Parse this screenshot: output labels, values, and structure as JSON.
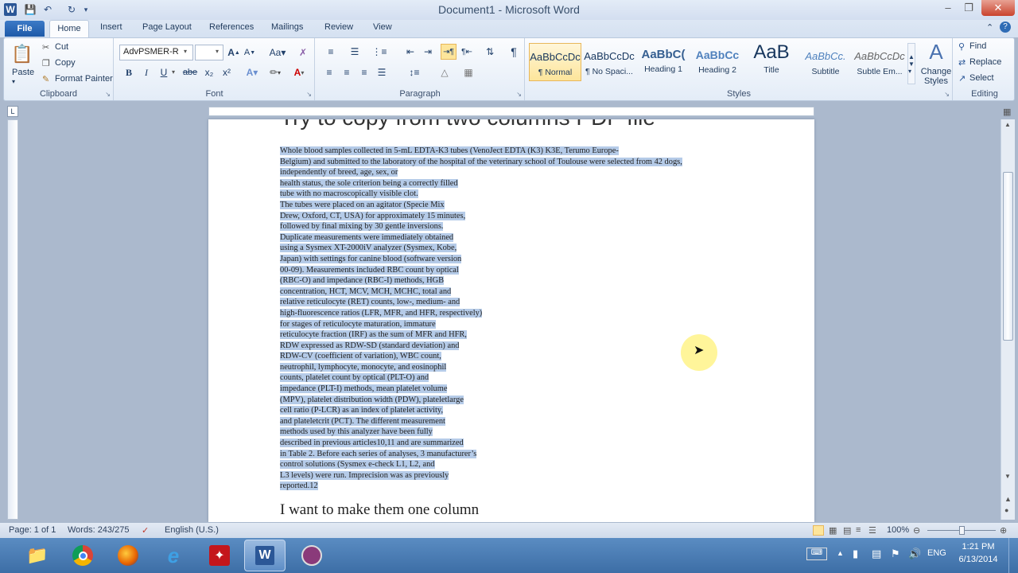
{
  "window": {
    "title": "Document1 - Microsoft Word"
  },
  "qat": {
    "word_icon": "W",
    "save_icon": "save-icon",
    "undo_icon": "undo-icon",
    "redo_icon": "redo-icon"
  },
  "tabs": [
    "File",
    "Home",
    "Insert",
    "Page Layout",
    "References",
    "Mailings",
    "Review",
    "View"
  ],
  "clipboard": {
    "paste": "Paste",
    "cut": "Cut",
    "copy": "Copy",
    "format_painter": "Format Painter",
    "label": "Clipboard"
  },
  "font": {
    "name": "AdvPSMER-R",
    "size": "",
    "label": "Font",
    "bold": "B",
    "italic": "I",
    "underline": "U",
    "strike": "abe",
    "sub": "x₂",
    "sup": "x²"
  },
  "paragraph": {
    "label": "Paragraph"
  },
  "styles": {
    "label": "Styles",
    "items": [
      {
        "preview": "AaBbCcDc",
        "name": "¶ Normal"
      },
      {
        "preview": "AaBbCcDc",
        "name": "¶ No Spaci..."
      },
      {
        "preview": "AaBbC(",
        "name": "Heading 1"
      },
      {
        "preview": "AaBbCc",
        "name": "Heading 2"
      },
      {
        "preview": "AaB",
        "name": "Title"
      },
      {
        "preview": "AaBbCc.",
        "name": "Subtitle"
      },
      {
        "preview": "AaBbCcDc",
        "name": "Subtle Em..."
      }
    ],
    "change_styles": "Change Styles"
  },
  "editing": {
    "label": "Editing",
    "find": "Find",
    "replace": "Replace",
    "select": "Select"
  },
  "document": {
    "heading": "Try to copy from two columns PDF file",
    "lines": [
      "Whole blood samples collected in 5-mL EDTA-K3 tubes (VenoJect EDTA (K3) K3E, Terumo Europe-",
      "Belgium) and submitted to the laboratory of the hospital of the veterinary school of Toulouse were selected from 42 dogs,",
      "independently of breed, age, sex, or",
      "health status, the sole criterion being a correctly filled",
      "tube with no macroscopically visible clot.",
      "The tubes were placed on an agitator (Specie Mix",
      "Drew, Oxford, CT, USA) for approximately 15 minutes,",
      "followed by final mixing by 30 gentle inversions.",
      "Duplicate measurements were immediately obtained",
      "using a Sysmex XT-2000iV analyzer (Sysmex, Kobe,",
      "Japan) with settings for canine blood (software version",
      "00-09). Measurements included RBC count by optical",
      "(RBC-O) and impedance (RBC-I) methods, HGB",
      "concentration, HCT, MCV, MCH, MCHC, total and",
      "relative reticulocyte (RET) counts, low-, medium- and",
      "high-fluorescence ratios (LFR, MFR, and HFR, respectively)",
      "for stages of reticulocyte maturation, immature",
      "reticulocyte fraction (IRF) as the sum of MFR and HFR,",
      "RDW expressed as RDW-SD (standard deviation) and",
      "RDW-CV (coefficient of variation), WBC count,",
      "neutrophil, lymphocyte, monocyte, and eosinophil",
      "counts, platelet count by optical (PLT-O) and",
      "impedance (PLT-I) methods, mean platelet volume",
      "(MPV), platelet distribution width (PDW), plateletlarge",
      "cell ratio (P-LCR) as an index of platelet activity,",
      "and plateletcrit (PCT). The different measurement",
      "methods used by this analyzer have been fully",
      "described in previous articles10,11 and are summarized",
      "in Table 2. Before each series of analyses, 3 manufacturer’s",
      "control solutions (Sysmex e-check L1, L2, and",
      "L3 levels) were run. Imprecision was as previously",
      "reported.12"
    ],
    "tail": "I want to make them one column"
  },
  "status": {
    "page": "Page: 1 of 1",
    "words": "Words: 243/275",
    "language": "English (U.S.)",
    "zoom": "100%"
  },
  "taskbar": {
    "lang": "ENG",
    "time": "1:21 PM",
    "date": "6/13/2014"
  }
}
